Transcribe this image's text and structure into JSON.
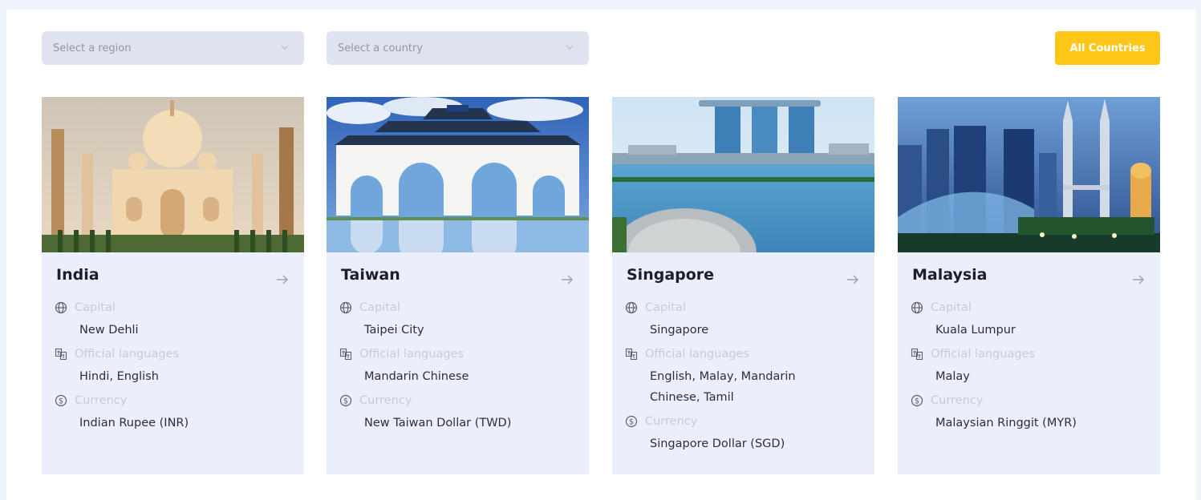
{
  "filters": {
    "region_placeholder": "Select a region",
    "country_placeholder": "Select a country",
    "all_button": "All Countries"
  },
  "labels": {
    "capital": "Capital",
    "languages": "Official languages",
    "currency": "Currency"
  },
  "colors": {
    "accent": "#fdc619",
    "card_bg": "#ebeffb",
    "page_bg": "#eef2f9"
  },
  "cards": [
    {
      "name": "India",
      "capital": "New Dehli",
      "languages": "Hindi, English",
      "currency": "Indian Rupee (INR)"
    },
    {
      "name": "Taiwan",
      "capital": "Taipei City",
      "languages": "Mandarin Chinese",
      "currency": "New Taiwan Dollar (TWD)"
    },
    {
      "name": "Singapore",
      "capital": "Singapore",
      "languages": "English, Malay, Mandarin Chinese, Tamil",
      "currency": "Singapore Dollar (SGD)"
    },
    {
      "name": "Malaysia",
      "capital": "Kuala Lumpur",
      "languages": "Malay",
      "currency": "Malaysian Ringgit (MYR)"
    }
  ]
}
